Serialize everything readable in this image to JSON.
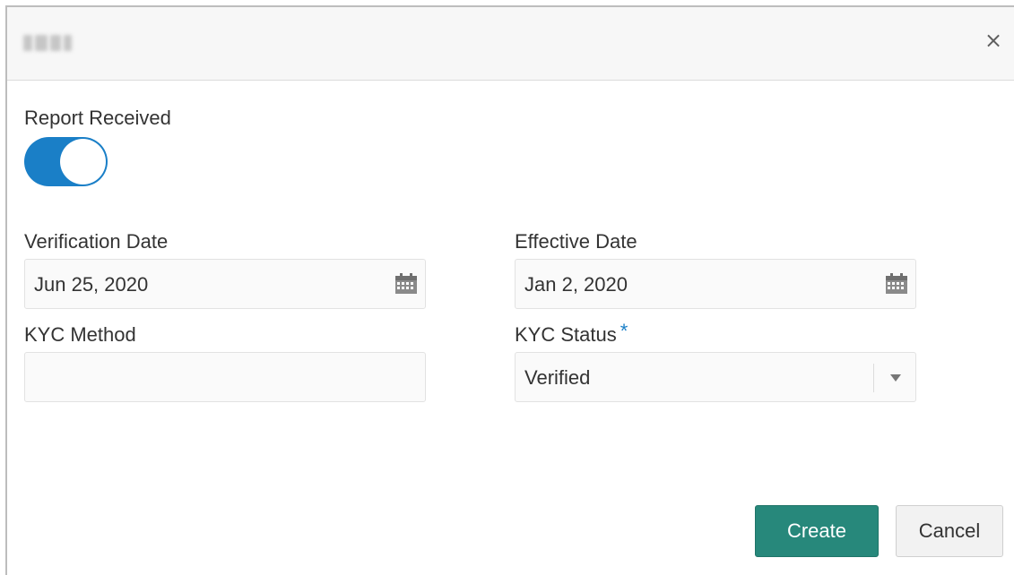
{
  "dialog": {
    "close_label": "×"
  },
  "form": {
    "report_received_label": "Report Received",
    "report_received_on": true,
    "verification_date_label": "Verification Date",
    "verification_date_value": "Jun 25, 2020",
    "effective_date_label": "Effective Date",
    "effective_date_value": "Jan 2, 2020",
    "kyc_method_label": "KYC Method",
    "kyc_method_value": "",
    "kyc_status_label": "KYC Status",
    "kyc_status_required": "*",
    "kyc_status_value": "Verified"
  },
  "actions": {
    "create_label": "Create",
    "cancel_label": "Cancel"
  },
  "colors": {
    "accent": "#1a7fc7",
    "primary_button": "#27887b"
  },
  "icons": {
    "close": "close-icon",
    "calendar": "calendar-icon",
    "dropdown": "chevron-down-icon"
  }
}
